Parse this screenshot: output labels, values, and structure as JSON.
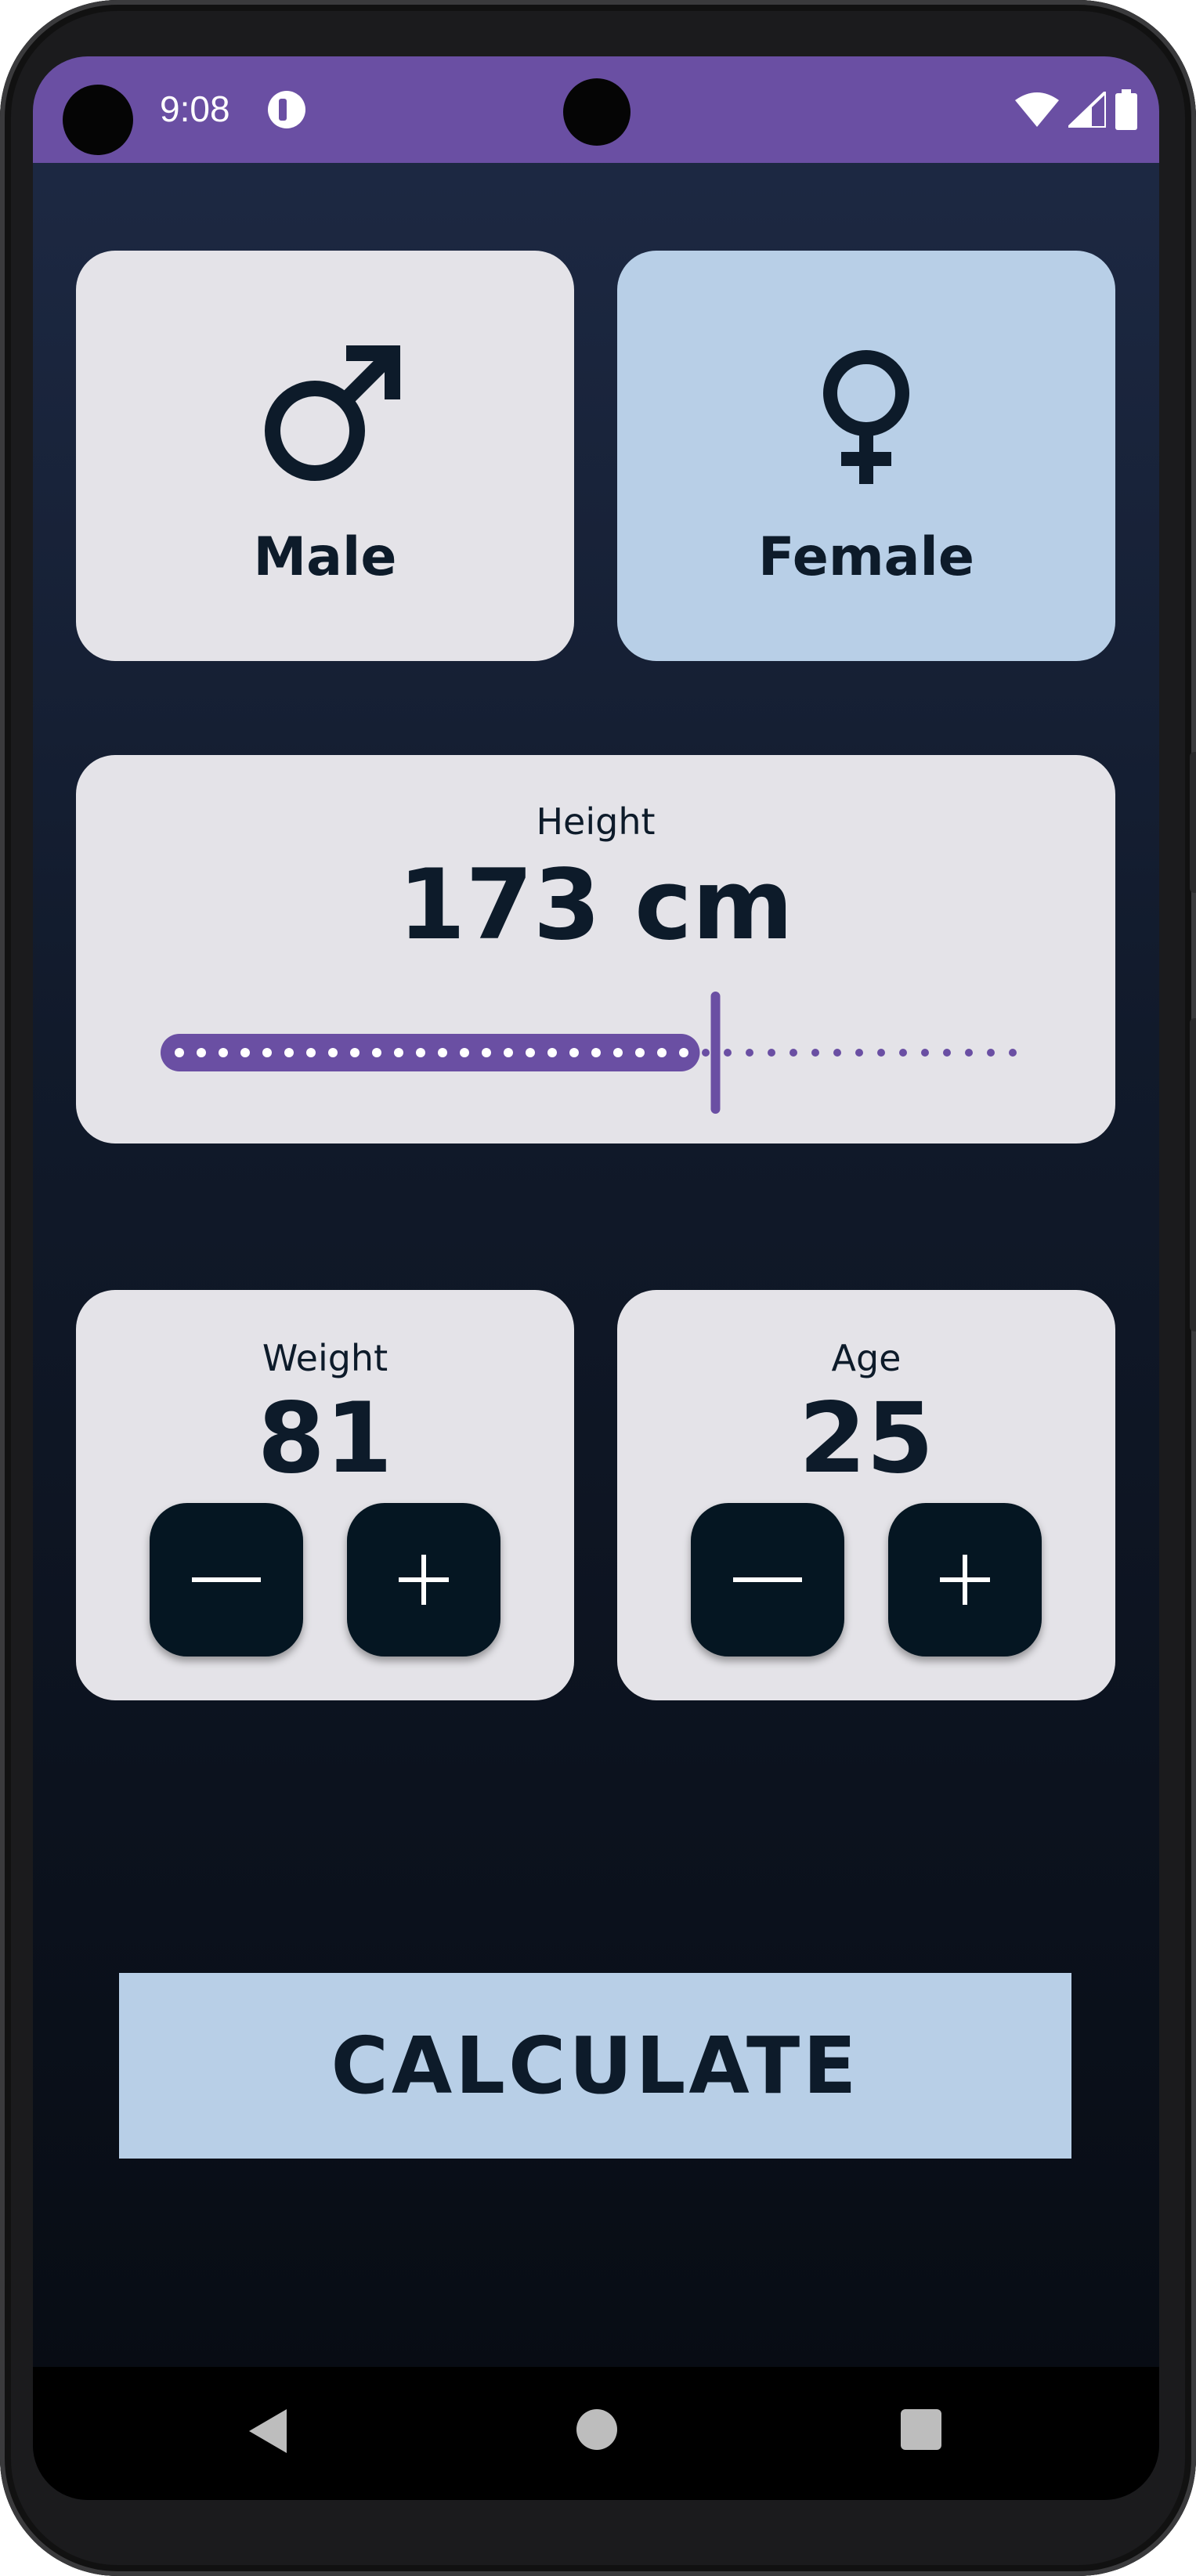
{
  "status_bar": {
    "time": "9:08",
    "icons": [
      "app-notification-icon",
      "wifi-icon",
      "signal-icon",
      "battery-icon"
    ]
  },
  "gender": {
    "male_label": "Male",
    "female_label": "Female",
    "selected": "female",
    "male_icon": "male-symbol-icon",
    "female_icon": "female-symbol-icon"
  },
  "height": {
    "title": "Height",
    "value_text": "173 cm",
    "slider_fraction": 0.65
  },
  "weight": {
    "title": "Weight",
    "value": "81",
    "minus_icon": "minus-icon",
    "plus_icon": "plus-icon"
  },
  "age": {
    "title": "Age",
    "value": "25",
    "minus_icon": "minus-icon",
    "plus_icon": "plus-icon"
  },
  "calculate": {
    "label": "CALCULATE"
  },
  "nav": {
    "icons": [
      "back-icon",
      "home-icon",
      "recents-icon"
    ]
  },
  "colors": {
    "accent": "#6a4fa3",
    "card": "#e4e3e8",
    "card_selected": "#b8cfe7",
    "button_dark": "#051622",
    "text_dark": "#0d1b2a"
  }
}
